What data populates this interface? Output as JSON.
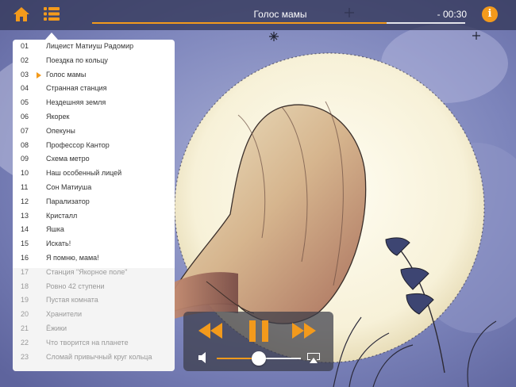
{
  "player": {
    "current_track_title": "Голос мамы",
    "time_remaining": "- 00:30",
    "progress_fraction": 0.79,
    "volume_fraction": 0.5,
    "info_label": "i",
    "icons": {
      "home": "home-icon",
      "playlist": "list-icon",
      "info": "info-icon",
      "rewind": "rewind-icon",
      "pause": "pause-icon",
      "fast_forward": "fast-forward-icon",
      "volume": "volume-icon",
      "airplay": "airplay-icon"
    },
    "accent_color": "#f39a1c"
  },
  "playlist": {
    "current_index": 2,
    "tracks": [
      {
        "num": "01",
        "title": "Лицеист Матиуш Радомир"
      },
      {
        "num": "02",
        "title": "Поездка по кольцу"
      },
      {
        "num": "03",
        "title": "Голос мамы"
      },
      {
        "num": "04",
        "title": "Странная станция"
      },
      {
        "num": "05",
        "title": "Нездешняя земля"
      },
      {
        "num": "06",
        "title": "Якорек"
      },
      {
        "num": "07",
        "title": "Опекуны"
      },
      {
        "num": "08",
        "title": "Профессор Кантор"
      },
      {
        "num": "09",
        "title": "Схема метро"
      },
      {
        "num": "10",
        "title": "Наш особенный лицей"
      },
      {
        "num": "11",
        "title": "Сон Матиуша"
      },
      {
        "num": "12",
        "title": "Парализатор"
      },
      {
        "num": "13",
        "title": "Кристалл"
      },
      {
        "num": "14",
        "title": "Яшка"
      },
      {
        "num": "15",
        "title": "Искать!"
      },
      {
        "num": "16",
        "title": "Я помню, мама!"
      },
      {
        "num": "17",
        "title": "Станция \"Якорное поле\""
      },
      {
        "num": "18",
        "title": "Ровно 42 ступени"
      },
      {
        "num": "19",
        "title": "Пустая комната"
      },
      {
        "num": "20",
        "title": "Хранители"
      },
      {
        "num": "21",
        "title": "Ёжики"
      },
      {
        "num": "22",
        "title": "Что творится на планете"
      },
      {
        "num": "23",
        "title": "Сломай привычный круг кольца"
      }
    ]
  }
}
